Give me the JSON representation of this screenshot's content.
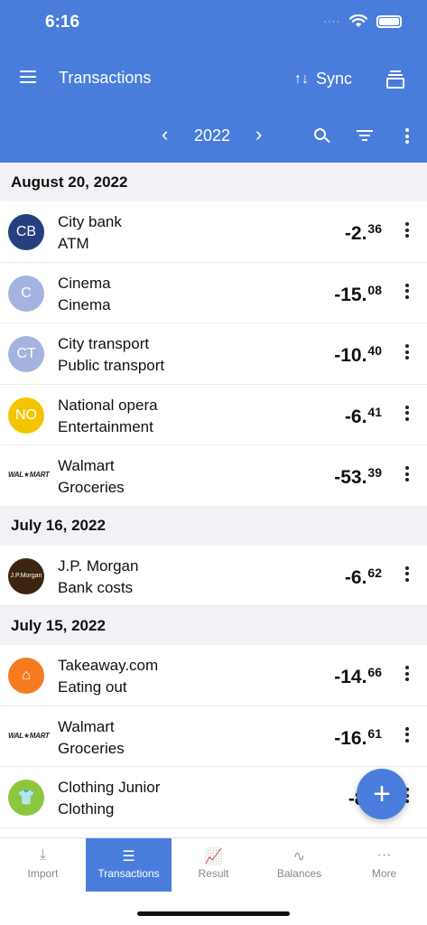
{
  "status": {
    "time": "6:16",
    "signal": "····"
  },
  "header": {
    "title": "Transactions",
    "sync_label": "Sync",
    "sync_icon": "↑↓",
    "year": "2022",
    "prev": "‹",
    "next": "›"
  },
  "colors": {
    "accent": "#4a7ddb"
  },
  "groups": [
    {
      "date": "August 20, 2022",
      "rows": [
        {
          "payee": "City bank",
          "category": "ATM",
          "amount_int": "-2.",
          "amount_dec": "36",
          "avatar": "CB",
          "avatar_color": "#263f7e"
        },
        {
          "payee": "Cinema",
          "category": "Cinema",
          "amount_int": "-15.",
          "amount_dec": "08",
          "avatar": "C",
          "avatar_color": "#a5b4de"
        },
        {
          "payee": "City transport",
          "category": "Public transport",
          "amount_int": "-10.",
          "amount_dec": "40",
          "avatar": "CT",
          "avatar_color": "#a5b4de"
        },
        {
          "payee": "National opera",
          "category": "Entertainment",
          "amount_int": "-6.",
          "amount_dec": "41",
          "avatar": "NO",
          "avatar_color": "#f5c400"
        },
        {
          "payee": "Walmart",
          "category": "Groceries",
          "amount_int": "-53.",
          "amount_dec": "39",
          "logo": "WAL★MART"
        }
      ]
    },
    {
      "date": "July 16, 2022",
      "rows": [
        {
          "payee": "J.P. Morgan",
          "category": "Bank costs",
          "amount_int": "-6.",
          "amount_dec": "62",
          "avatar": "J.P.Morgan",
          "avatar_color": "#3b2511"
        }
      ]
    },
    {
      "date": "July 15, 2022",
      "rows": [
        {
          "payee": "Takeaway.com",
          "category": "Eating out",
          "amount_int": "-14.",
          "amount_dec": "66",
          "avatar": "⌂",
          "avatar_color": "#f47b20"
        },
        {
          "payee": "Walmart",
          "category": "Groceries",
          "amount_int": "-16.",
          "amount_dec": "61",
          "logo": "WAL★MART"
        },
        {
          "payee": "Clothing Junior",
          "category": "Clothing",
          "amount_int": "-86.",
          "amount_dec": "",
          "avatar": "👕",
          "avatar_color": "#8dc63f"
        }
      ]
    }
  ],
  "fab": {
    "label": "+"
  },
  "tabs": [
    {
      "label": "Import",
      "icon": "⤓"
    },
    {
      "label": "Transactions",
      "icon": "☰"
    },
    {
      "label": "Result",
      "icon": "📈"
    },
    {
      "label": "Balances",
      "icon": "∿"
    },
    {
      "label": "More",
      "icon": "···"
    }
  ]
}
